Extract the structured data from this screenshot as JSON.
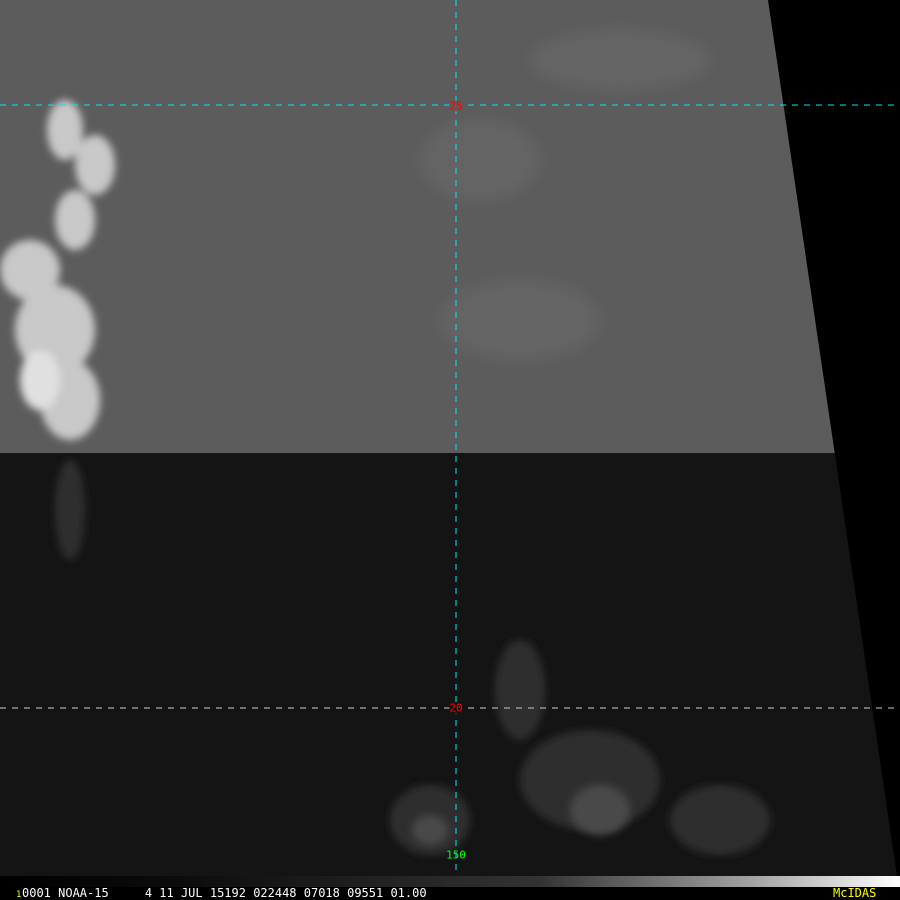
{
  "image": {
    "grid_labels": {
      "lat_upper": "25",
      "lat_lower": "20",
      "lon": "150"
    },
    "colors": {
      "lat_label": "#ff0000",
      "lon_label": "#00ff00",
      "grid_cyan": "#00e5ff",
      "grid_white": "#cccccc",
      "brand": "#ffff00"
    }
  },
  "status_bar": {
    "frame_number": "1",
    "info_text": "0001 NOAA-15     4 11 JUL 15192 022448 07018 09551 01.00",
    "brand": "McIDAS"
  }
}
